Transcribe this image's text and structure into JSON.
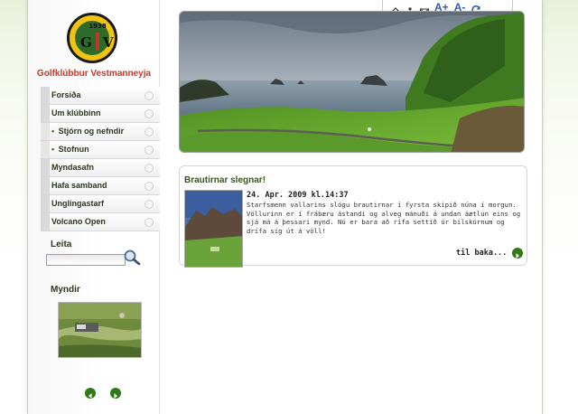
{
  "club": {
    "name": "Golfklúbbur Vestmanneyja",
    "logo_year": "1938",
    "logo_left_letter": "G",
    "logo_right_letter": "V",
    "brand_color": "#c0392b"
  },
  "toolbar": {
    "icons": [
      "home-icon",
      "sitemap-icon",
      "email-icon",
      "refresh-icon"
    ],
    "increase_font": "A+",
    "decrease_font": "A-"
  },
  "nav": {
    "items": [
      {
        "label": "Forsíða",
        "sub": false
      },
      {
        "label": "Um klúbbinn",
        "sub": false
      },
      {
        "label": "Stjórn og nefndir",
        "sub": true
      },
      {
        "label": "Stofnun",
        "sub": true
      },
      {
        "label": "Myndasafn",
        "sub": false
      },
      {
        "label": "Hafa samband",
        "sub": false
      },
      {
        "label": "Unglingastarf",
        "sub": false
      },
      {
        "label": "Volcano Open",
        "sub": false
      }
    ],
    "bullet": "•"
  },
  "search": {
    "label": "Leita",
    "value": ""
  },
  "gallery": {
    "label": "Myndir"
  },
  "news": {
    "title": "Brautirnar slegnar!",
    "date": "24. Apr. 2009 kl.14:37",
    "body": "Starfsmenn vallarins slógu brautirnar í fyrsta skipið núna í morgun. Völlurinn er í frábæru ástandi og alveg mánuði á undan áætlun eins og sjá má á þessari mynd. Nú er bara að rífa settið úr bílskúrnum og drífa sig út á völl!",
    "back_label": "til baka..."
  },
  "colors": {
    "accent_green": "#2f7a12",
    "text_dark_green": "#2f5a14",
    "toolbar_blue": "#2f5fa6"
  }
}
